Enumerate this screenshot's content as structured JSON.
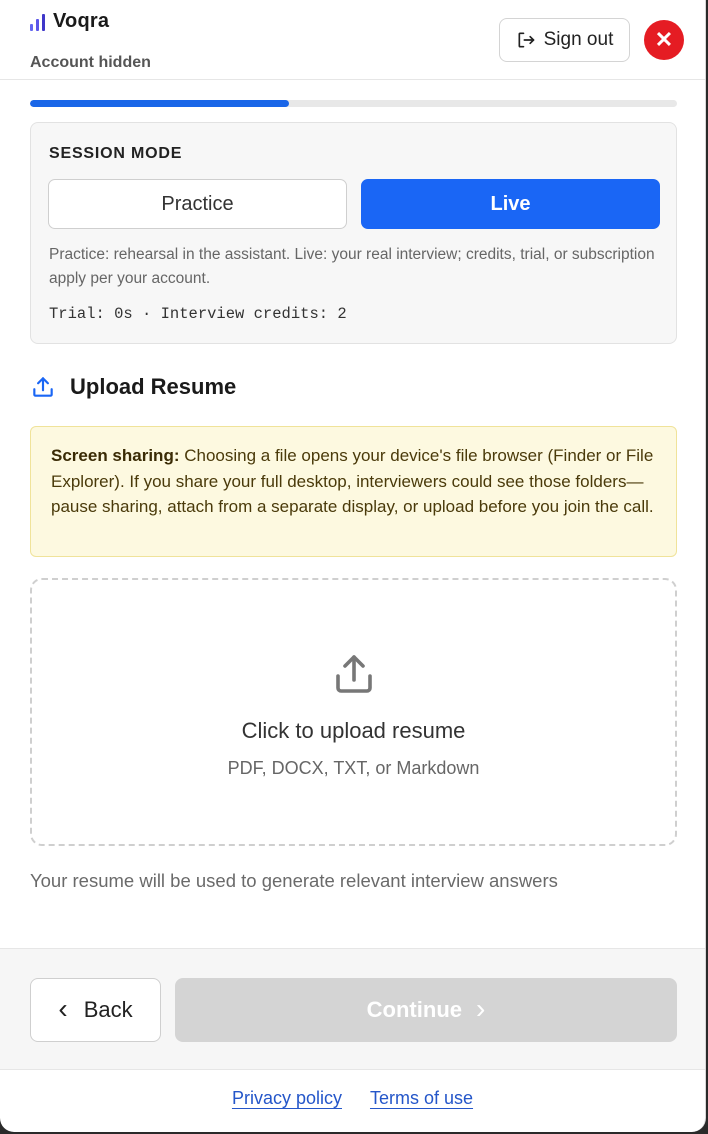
{
  "header": {
    "brand_name": "Voqra",
    "account_label": "Account hidden",
    "signout_label": "Sign out",
    "close_glyph": "✕"
  },
  "progress": {
    "percent": 40
  },
  "session": {
    "title": "SESSION MODE",
    "practice_label": "Practice",
    "live_label": "Live",
    "selected": "Live",
    "description": "Practice: rehearsal in the assistant. Live: your real interview; credits, trial, or subscription apply per your account.",
    "meta": "Trial: 0s · Interview credits: 2"
  },
  "upload": {
    "section_title": "Upload Resume",
    "warning_bold": "Screen sharing:",
    "warning_text": " Choosing a file opens your device's file browser (Finder or File Explorer). If you share your full desktop, interviewers could see those folders—pause sharing, attach from a separate display, or upload before you join the call.",
    "drop_title": "Click to upload resume",
    "drop_sub": "PDF, DOCX, TXT, or Markdown",
    "helper": "Your resume will be used to generate relevant interview answers"
  },
  "nav": {
    "back_label": "Back",
    "continue_label": "Continue",
    "back_glyph": "‹",
    "continue_glyph": "›"
  },
  "footer": {
    "privacy_label": "Privacy policy",
    "terms_label": "Terms of use"
  },
  "colors": {
    "accent": "#1a66f5",
    "close": "#e51c23",
    "warning_bg": "#fdf9e0",
    "disabled": "#d4d4d4"
  },
  "icons": [
    "bar-chart-icon",
    "sign-out-icon",
    "close-icon",
    "upload-icon",
    "chevron-left-icon",
    "chevron-right-icon"
  ]
}
